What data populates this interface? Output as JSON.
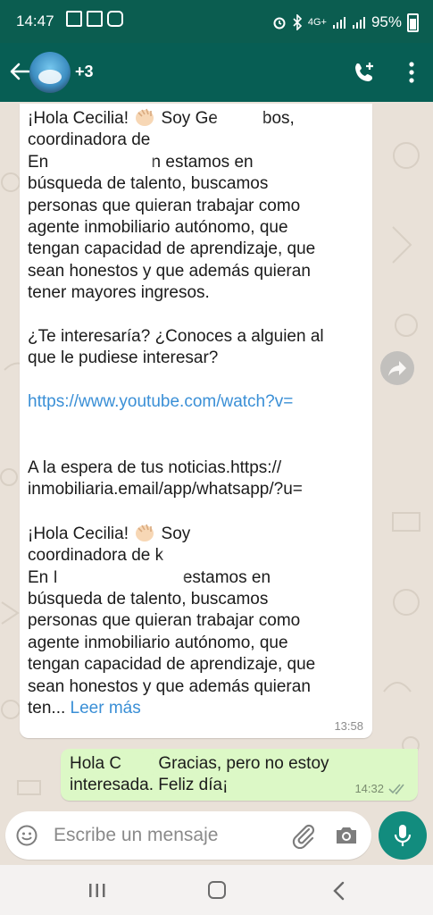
{
  "status_bar": {
    "time": "14:47",
    "network": "4G+",
    "battery": "95%"
  },
  "header": {
    "contact_name": "+3",
    "colors": {
      "header_bg": "#075e54",
      "status_bg": "#0b5d50"
    }
  },
  "chat": {
    "incoming": {
      "greeting_1": "¡Hola Cecilia! ",
      "greeting_1_rest": " Soy Ge",
      "greeting_1_tail": "bos,",
      "line_coord_1": "coordinadora de ",
      "line_en_1_a": "En ",
      "line_en_1_b": "n estamos en",
      "body_1": "búsqueda de talento, buscamos\npersonas que quieran trabajar como\nagente inmobiliario autónomo, que\ntengan capacidad de aprendizaje, que\nsean honestos y que además quieran\ntener mayores ingresos.",
      "question": "¿Te interesaría? ¿Conoces a alguien al\nque le pudiese interesar?",
      "link": "https://www.youtube.com/watch?v=",
      "waiting": "A la espera de tus noticias.https://\ninmobiliaria.email/app/whatsapp/?u=",
      "greeting_2": "¡Hola Cecilia! ",
      "greeting_2_rest": " Soy",
      "line_coord_2": "coordinadora de k",
      "line_en_2_a": "En I",
      "line_en_2_b": "estamos en",
      "body_2": "búsqueda de talento, buscamos\npersonas que quieran trabajar como\nagente inmobiliario autónomo, que\ntengan capacidad de aprendizaje, que\nsean honestos y que además quieran",
      "truncated": "ten...",
      "read_more": "Leer más",
      "time": "13:58",
      "emoji": "waving-hand"
    },
    "outgoing": {
      "text_a": "Hola C",
      "text_b": " Gracias, pero no estoy",
      "text_c": "interesada. Feliz día¡",
      "time": "14:32",
      "status": "read"
    }
  },
  "composer": {
    "placeholder": "Escribe un mensaje"
  }
}
